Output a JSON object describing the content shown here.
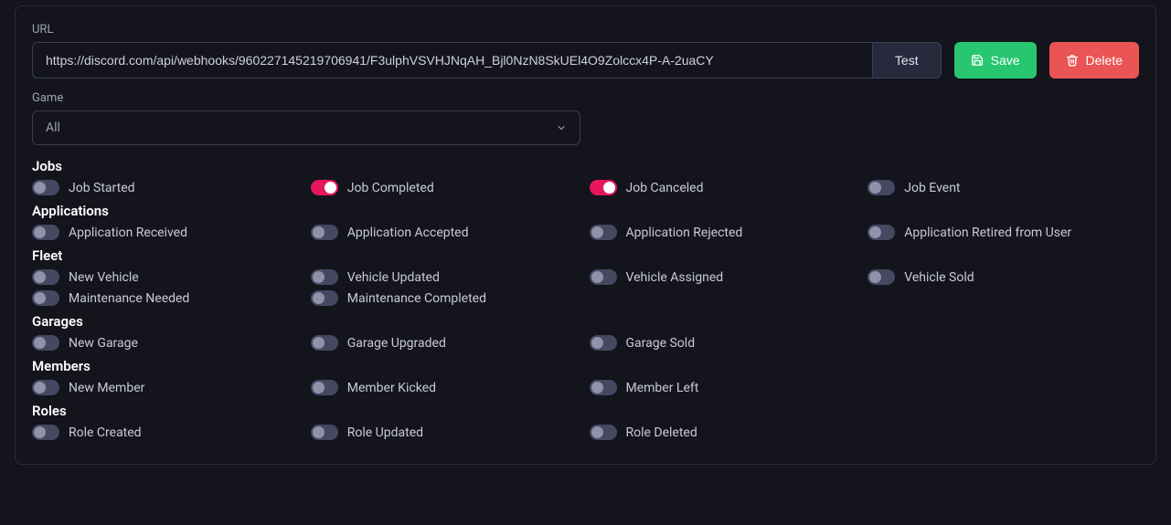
{
  "url": {
    "label": "URL",
    "value": "https://discord.com/api/webhooks/960227145219706941/F3ulphVSVHJNqAH_Bjl0NzN8SkUEl4O9Zolccx4P-A-2uaCY",
    "test_label": "Test"
  },
  "buttons": {
    "save": "Save",
    "delete": "Delete"
  },
  "game": {
    "label": "Game",
    "selected": "All"
  },
  "sections": [
    {
      "id": "jobs",
      "title": "Jobs",
      "items": [
        {
          "id": "job-started",
          "label": "Job Started",
          "on": false
        },
        {
          "id": "job-completed",
          "label": "Job Completed",
          "on": true
        },
        {
          "id": "job-canceled",
          "label": "Job Canceled",
          "on": true
        },
        {
          "id": "job-event",
          "label": "Job Event",
          "on": false
        }
      ]
    },
    {
      "id": "applications",
      "title": "Applications",
      "items": [
        {
          "id": "application-received",
          "label": "Application Received",
          "on": false
        },
        {
          "id": "application-accepted",
          "label": "Application Accepted",
          "on": false
        },
        {
          "id": "application-rejected",
          "label": "Application Rejected",
          "on": false
        },
        {
          "id": "application-retired",
          "label": "Application Retired from User",
          "on": false
        }
      ]
    },
    {
      "id": "fleet",
      "title": "Fleet",
      "items": [
        {
          "id": "new-vehicle",
          "label": "New Vehicle",
          "on": false
        },
        {
          "id": "vehicle-updated",
          "label": "Vehicle Updated",
          "on": false
        },
        {
          "id": "vehicle-assigned",
          "label": "Vehicle Assigned",
          "on": false
        },
        {
          "id": "vehicle-sold",
          "label": "Vehicle Sold",
          "on": false
        },
        {
          "id": "maintenance-needed",
          "label": "Maintenance Needed",
          "on": false
        },
        {
          "id": "maintenance-completed",
          "label": "Maintenance Completed",
          "on": false
        }
      ]
    },
    {
      "id": "garages",
      "title": "Garages",
      "items": [
        {
          "id": "new-garage",
          "label": "New Garage",
          "on": false
        },
        {
          "id": "garage-upgraded",
          "label": "Garage Upgraded",
          "on": false
        },
        {
          "id": "garage-sold",
          "label": "Garage Sold",
          "on": false
        }
      ]
    },
    {
      "id": "members",
      "title": "Members",
      "items": [
        {
          "id": "new-member",
          "label": "New Member",
          "on": false
        },
        {
          "id": "member-kicked",
          "label": "Member Kicked",
          "on": false
        },
        {
          "id": "member-left",
          "label": "Member Left",
          "on": false
        }
      ]
    },
    {
      "id": "roles",
      "title": "Roles",
      "items": [
        {
          "id": "role-created",
          "label": "Role Created",
          "on": false
        },
        {
          "id": "role-updated",
          "label": "Role Updated",
          "on": false
        },
        {
          "id": "role-deleted",
          "label": "Role Deleted",
          "on": false
        }
      ]
    }
  ]
}
